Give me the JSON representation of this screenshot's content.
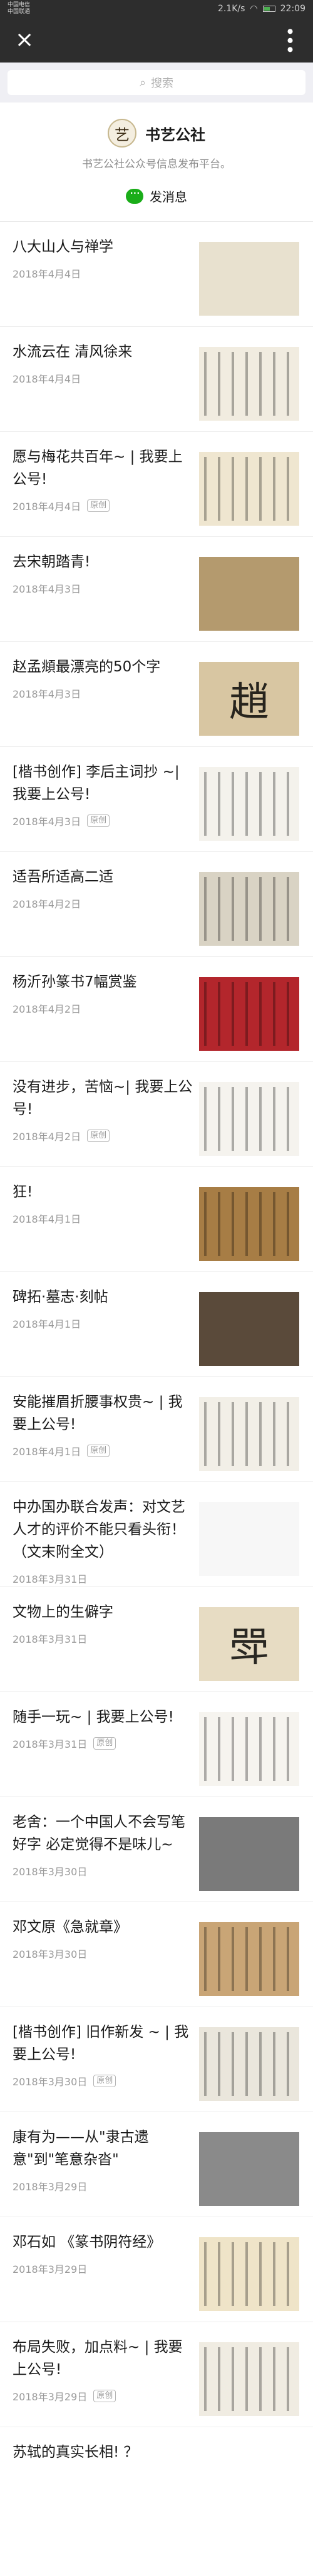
{
  "status_bar": {
    "carrier_line1": "中国电信",
    "carrier_line2": "中国联通",
    "speed": "2.1K/s",
    "time": "22:09"
  },
  "nav": {
    "close_icon": "close-icon",
    "more_icon": "more-icon"
  },
  "search": {
    "placeholder": "搜索"
  },
  "account": {
    "logo_char": "艺",
    "name": "书艺公社",
    "description": "书艺公社公众号信息发布平台。",
    "send_message_label": "发消息"
  },
  "colors": {
    "status_bar_bg": "#2d2d2d",
    "accent_green": "#1aad19",
    "page_bg": "#ffffff"
  },
  "articles": [
    {
      "title": "八大山人与禅学",
      "date": "2018年4月4日",
      "tag": "",
      "thumb_char": "",
      "thumb_bg": "#e8e1cf",
      "thumb_style": "plain"
    },
    {
      "title": "水流云在 清风徐来",
      "date": "2018年4月4日",
      "tag": "",
      "thumb_char": "",
      "thumb_bg": "#f1ece0",
      "thumb_style": "lines"
    },
    {
      "title": "愿与梅花共百年~ | 我要上公号!",
      "date": "2018年4月4日",
      "tag": "原创",
      "thumb_char": "",
      "thumb_bg": "#efe6d0",
      "thumb_style": "lines"
    },
    {
      "title": "去宋朝踏青!",
      "date": "2018年4月3日",
      "tag": "",
      "thumb_char": "",
      "thumb_bg": "#b49a6e",
      "thumb_style": "plain"
    },
    {
      "title": "赵孟頫最漂亮的50个字",
      "date": "2018年4月3日",
      "tag": "",
      "thumb_char": "趙",
      "thumb_bg": "#d8c6a2",
      "thumb_style": "glyph"
    },
    {
      "title": "[楷书创作] 李后主词抄 ~| 我要上公号!",
      "date": "2018年4月3日",
      "tag": "原创",
      "thumb_char": "",
      "thumb_bg": "#f4f2ec",
      "thumb_style": "lines"
    },
    {
      "title": "适吾所适高二适",
      "date": "2018年4月2日",
      "tag": "",
      "thumb_char": "",
      "thumb_bg": "#d9d3c4",
      "thumb_style": "lines"
    },
    {
      "title": "杨沂孙篆书7幅赏鉴",
      "date": "2018年4月2日",
      "tag": "",
      "thumb_char": "",
      "thumb_bg": "#b3262c",
      "thumb_style": "lines"
    },
    {
      "title": "没有进步，苦恼~| 我要上公号!",
      "date": "2018年4月2日",
      "tag": "原创",
      "thumb_char": "",
      "thumb_bg": "#f5f3ee",
      "thumb_style": "lines"
    },
    {
      "title": "狂!",
      "date": "2018年4月1日",
      "tag": "",
      "thumb_char": "",
      "thumb_bg": "#a77d45",
      "thumb_style": "lines"
    },
    {
      "title": "碑拓·墓志·刻帖",
      "date": "2018年4月1日",
      "tag": "",
      "thumb_char": "",
      "thumb_bg": "#5a4a3a",
      "thumb_style": "plain"
    },
    {
      "title": "安能摧眉折腰事权贵~ | 我要上公号!",
      "date": "2018年4月1日",
      "tag": "原创",
      "thumb_char": "",
      "thumb_bg": "#f2efe7",
      "thumb_style": "lines"
    },
    {
      "title": "中办国办联合发声：对文艺人才的评价不能只看头衔！（文末附全文）",
      "date": "2018年3月31日",
      "tag": "",
      "thumb_char": "",
      "thumb_bg": "#f7f7f7",
      "thumb_style": "plain"
    },
    {
      "title": "文物上的生僻字",
      "date": "2018年3月31日",
      "tag": "",
      "thumb_char": "斝",
      "thumb_bg": "#e7dcc3",
      "thumb_style": "glyph"
    },
    {
      "title": "随手一玩~ | 我要上公号!",
      "date": "2018年3月31日",
      "tag": "原创",
      "thumb_char": "",
      "thumb_bg": "#f6f4ef",
      "thumb_style": "lines"
    },
    {
      "title": "老舍：一个中国人不会写笔好字 必定觉得不是味儿~",
      "date": "2018年3月30日",
      "tag": "",
      "thumb_char": "",
      "thumb_bg": "#7a7a7a",
      "thumb_style": "plain"
    },
    {
      "title": "邓文原《急就章》",
      "date": "2018年3月30日",
      "tag": "",
      "thumb_char": "",
      "thumb_bg": "#c9a576",
      "thumb_style": "lines"
    },
    {
      "title": "[楷书创作] 旧作新发 ~ | 我要上公号!",
      "date": "2018年3月30日",
      "tag": "原创",
      "thumb_char": "",
      "thumb_bg": "#eae6dc",
      "thumb_style": "lines"
    },
    {
      "title": "康有为——从\"隶古遗意\"到\"笔意杂沓\"",
      "date": "2018年3月29日",
      "tag": "",
      "thumb_char": "",
      "thumb_bg": "#8a8a8a",
      "thumb_style": "plain"
    },
    {
      "title": "邓石如 《篆书阴符经》",
      "date": "2018年3月29日",
      "tag": "",
      "thumb_char": "",
      "thumb_bg": "#efe4c8",
      "thumb_style": "lines"
    },
    {
      "title": "布局失败，加点料~ | 我要上公号!",
      "date": "2018年3月29日",
      "tag": "原创",
      "thumb_char": "",
      "thumb_bg": "#f0ece2",
      "thumb_style": "lines"
    }
  ],
  "partial_article": {
    "title": "苏轼的真实长相! ？"
  }
}
